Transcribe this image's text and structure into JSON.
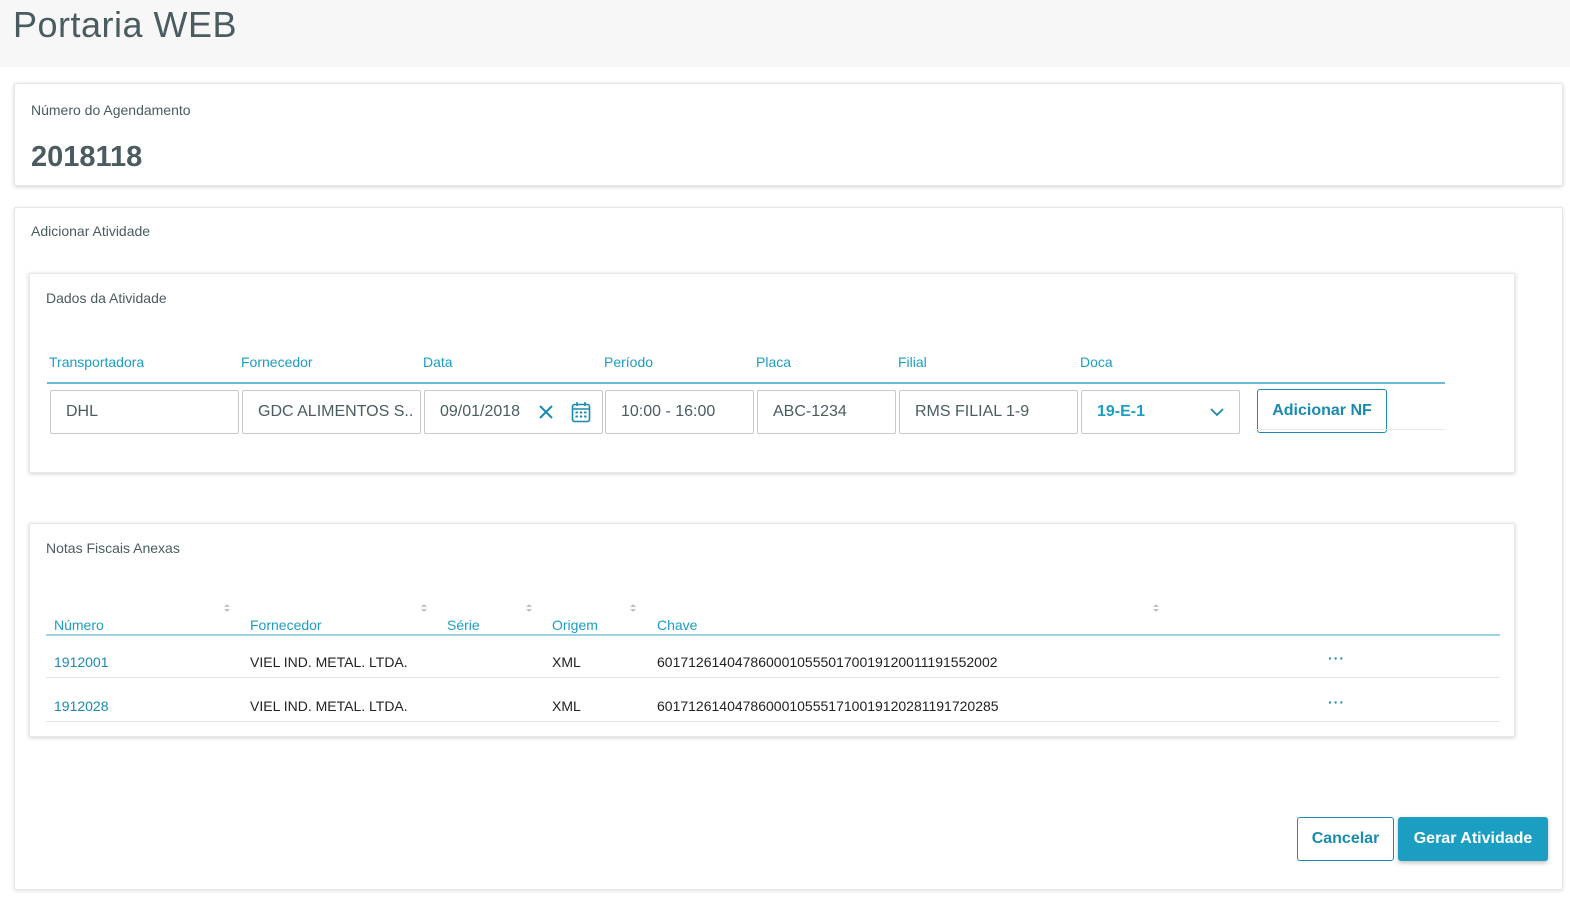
{
  "app": {
    "title": "Portaria WEB"
  },
  "agendamento": {
    "label": "Número do Agendamento",
    "value": "2018118"
  },
  "atividade": {
    "title": "Adicionar Atividade",
    "dados": {
      "title": "Dados da Atividade",
      "labels": {
        "transportadora": "Transportadora",
        "fornecedor": "Fornecedor",
        "data": "Data",
        "periodo": "Período",
        "placa": "Placa",
        "filial": "Filial",
        "doca": "Doca"
      },
      "values": {
        "transportadora": "DHL",
        "fornecedor": "GDC ALIMENTOS S..",
        "data": "09/01/2018",
        "periodo": "10:00 - 16:00",
        "placa": "ABC-1234",
        "filial": "RMS FILIAL 1-9",
        "doca": "19-E-1"
      },
      "add_nf_label": "Adicionar NF"
    },
    "notas": {
      "title": "Notas Fiscais Anexas",
      "columns": [
        "Número",
        "Fornecedor",
        "Série",
        "Origem",
        "Chave"
      ],
      "rows": [
        {
          "numero": "1912001",
          "fornecedor": "VIEL IND. METAL. LTDA.",
          "serie": "",
          "origem": "XML",
          "chave": "60171261404786000105550170019120011191552002",
          "actions": "···"
        },
        {
          "numero": "1912028",
          "fornecedor": "VIEL IND. METAL. LTDA.",
          "serie": "",
          "origem": "XML",
          "chave": "60171261404786000105551710019120281191720285",
          "actions": "···"
        }
      ]
    },
    "buttons": {
      "cancel": "Cancelar",
      "submit": "Gerar Atividade"
    }
  },
  "icons": {
    "clear": "close-icon",
    "calendar": "calendar-icon",
    "dropdown": "chevron-down-icon",
    "sort": "sort-icon",
    "more": "more-icon"
  },
  "colors": {
    "accent": "#1b9ec2",
    "button_primary": "#1b9ec2",
    "text": "#4a5c60"
  }
}
